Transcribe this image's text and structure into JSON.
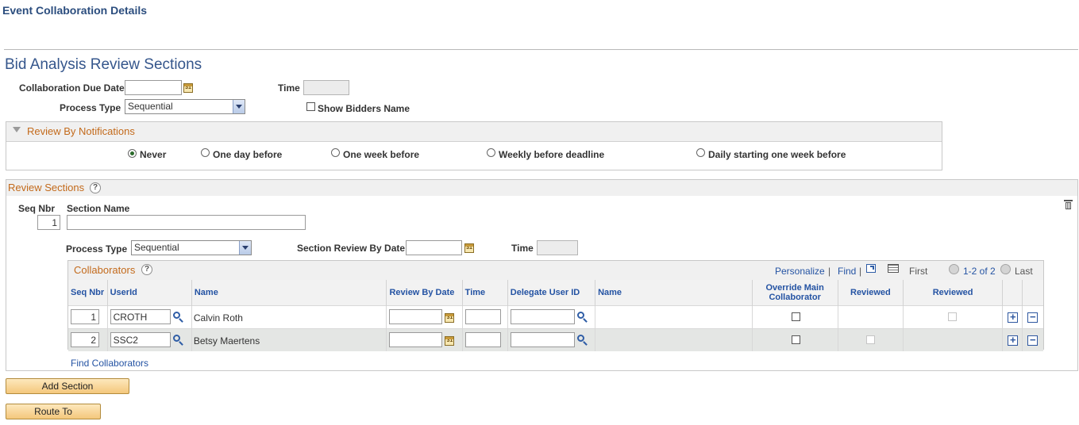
{
  "page": {
    "title": "Event Collaboration Details",
    "section_title": "Bid Analysis Review Sections"
  },
  "header_form": {
    "due_date_label": "Collaboration Due Date",
    "due_date_value": "",
    "time_label": "Time",
    "time_value": "",
    "process_type_label": "Process Type",
    "process_type_value": "Sequential",
    "show_bidders_label": "Show Bidders Name",
    "show_bidders_checked": false
  },
  "notifications": {
    "header": "Review By Notifications",
    "options": [
      "Never",
      "One day before",
      "One week before",
      "Weekly before deadline",
      "Daily starting one week before"
    ],
    "selected": "Never"
  },
  "review_sections": {
    "header": "Review Sections",
    "seq_label": "Seq Nbr",
    "seq_value": "1",
    "section_name_label": "Section Name",
    "section_name_value": "",
    "process_type_label": "Process Type",
    "process_type_value": "Sequential",
    "review_by_date_label": "Section Review By Date",
    "review_by_date_value": "",
    "time_label": "Time",
    "time_value": ""
  },
  "collaborators": {
    "header": "Collaborators",
    "personalize": "Personalize",
    "find": "Find",
    "first": "First",
    "range": "1-2 of 2",
    "last": "Last",
    "columns": {
      "seq": "Seq Nbr",
      "userid": "UserId",
      "name": "Name",
      "review_date": "Review By Date",
      "time": "Time",
      "delegate": "Delegate User ID",
      "name2": "Name",
      "override": "Override Main Collaborator",
      "reviewed1": "Reviewed",
      "reviewed2": "Reviewed"
    },
    "rows": [
      {
        "seq": "1",
        "userid": "CROTH",
        "name": "Calvin Roth",
        "review_date": "",
        "time": "",
        "delegate": ""
      },
      {
        "seq": "2",
        "userid": "SSC2",
        "name": "Betsy Maertens",
        "review_date": "",
        "time": "",
        "delegate": ""
      }
    ],
    "find_link": "Find Collaborators"
  },
  "buttons": {
    "add_section": "Add Section",
    "route_to": "Route To"
  },
  "icons": {
    "calendar": "31",
    "help": "?",
    "plus": "+",
    "minus": "−"
  }
}
